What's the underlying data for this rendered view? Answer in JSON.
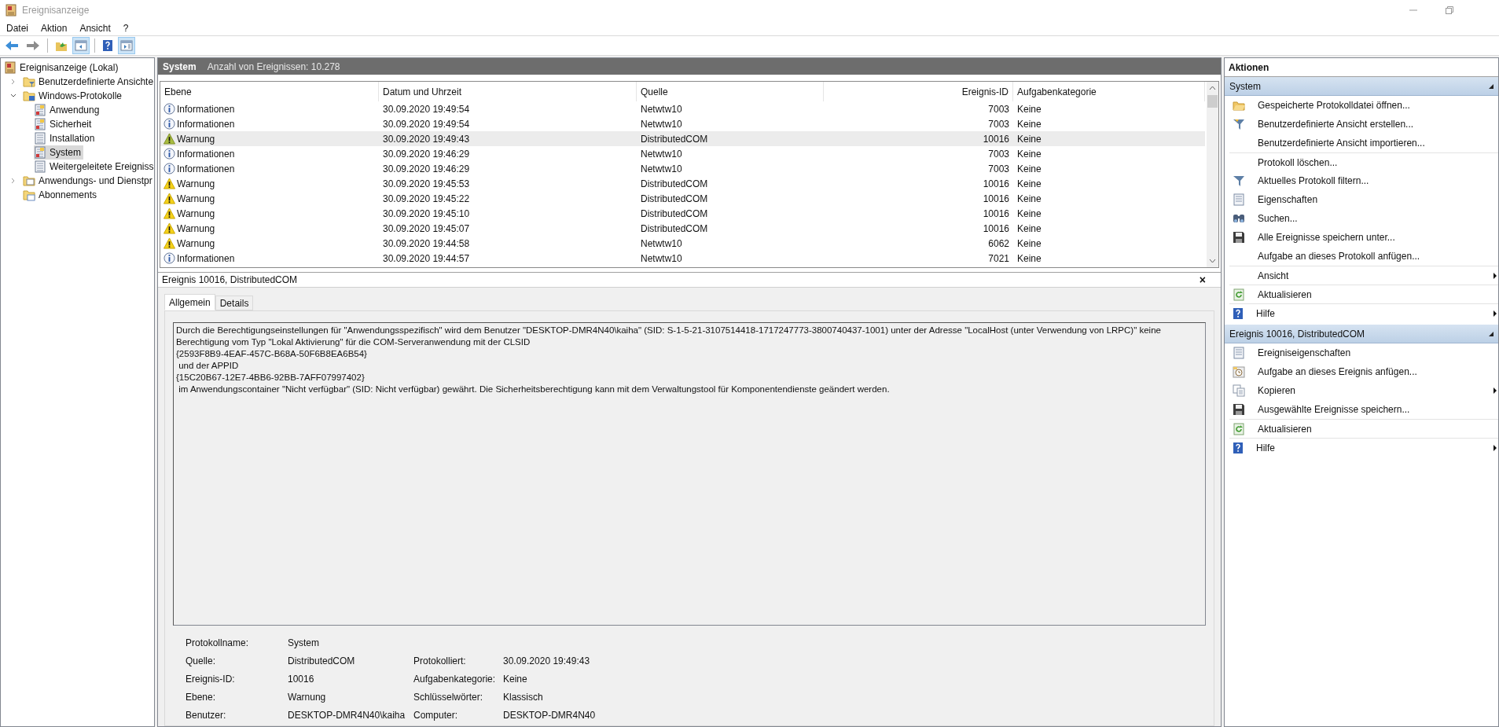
{
  "window": {
    "title": "Ereignisanzeige"
  },
  "menu": [
    "Datei",
    "Aktion",
    "Ansicht",
    "?"
  ],
  "toolbar": [
    {
      "buttons": [
        {
          "kind": "back",
          "selected": false
        },
        {
          "kind": "forward",
          "selected": false
        }
      ]
    },
    {
      "buttons": [
        {
          "kind": "up",
          "selected": false
        },
        {
          "kind": "tree-toggle",
          "selected": true
        }
      ]
    },
    {
      "buttons": [
        {
          "kind": "help",
          "selected": false
        },
        {
          "kind": "actions-toggle",
          "selected": true
        }
      ]
    }
  ],
  "tree": [
    {
      "label": "Ereignisanzeige (Lokal)",
      "kind": "app",
      "selected": false,
      "children": [
        {
          "label": "Benutzerdefinierte Ansichte",
          "kind": "folder-filter",
          "selected": false,
          "expanded": false
        },
        {
          "label": "Windows-Protokolle",
          "kind": "folder-pc",
          "selected": false,
          "expanded": true,
          "children": [
            {
              "label": "Anwendung",
              "kind": "log-marked",
              "selected": false
            },
            {
              "label": "Sicherheit",
              "kind": "log-marked",
              "selected": false
            },
            {
              "label": "Installation",
              "kind": "log",
              "selected": false
            },
            {
              "label": "System",
              "kind": "log-marked",
              "selected": true
            },
            {
              "label": "Weitergeleitete Ereigniss",
              "kind": "log",
              "selected": false
            }
          ]
        },
        {
          "label": "Anwendungs- und Dienstpr",
          "kind": "folder-doc",
          "selected": false,
          "expanded": false
        },
        {
          "label": "Abonnements",
          "kind": "folder-calendar",
          "selected": false
        }
      ]
    }
  ],
  "log_header": {
    "title": "System",
    "count": "Anzahl von Ereignissen: 10.278"
  },
  "table": {
    "columns": [
      "Ebene",
      "Datum und Uhrzeit",
      "Quelle",
      "Ereignis-ID",
      "Aufgabenkategorie"
    ],
    "rows": [
      {
        "kind": "info",
        "level": "Informationen",
        "date": "30.09.2020 19:49:54",
        "source": "Netwtw10",
        "id": "7003",
        "category": "Keine",
        "selected": false
      },
      {
        "kind": "info",
        "level": "Informationen",
        "date": "30.09.2020 19:49:54",
        "source": "Netwtw10",
        "id": "7003",
        "category": "Keine",
        "selected": false
      },
      {
        "kind": "warning",
        "level": "Warnung",
        "date": "30.09.2020 19:49:43",
        "source": "DistributedCOM",
        "id": "10016",
        "category": "Keine",
        "selected": true
      },
      {
        "kind": "info",
        "level": "Informationen",
        "date": "30.09.2020 19:46:29",
        "source": "Netwtw10",
        "id": "7003",
        "category": "Keine",
        "selected": false
      },
      {
        "kind": "info",
        "level": "Informationen",
        "date": "30.09.2020 19:46:29",
        "source": "Netwtw10",
        "id": "7003",
        "category": "Keine",
        "selected": false
      },
      {
        "kind": "warning",
        "level": "Warnung",
        "date": "30.09.2020 19:45:53",
        "source": "DistributedCOM",
        "id": "10016",
        "category": "Keine",
        "selected": false
      },
      {
        "kind": "warning",
        "level": "Warnung",
        "date": "30.09.2020 19:45:22",
        "source": "DistributedCOM",
        "id": "10016",
        "category": "Keine",
        "selected": false
      },
      {
        "kind": "warning",
        "level": "Warnung",
        "date": "30.09.2020 19:45:10",
        "source": "DistributedCOM",
        "id": "10016",
        "category": "Keine",
        "selected": false
      },
      {
        "kind": "warning",
        "level": "Warnung",
        "date": "30.09.2020 19:45:07",
        "source": "DistributedCOM",
        "id": "10016",
        "category": "Keine",
        "selected": false
      },
      {
        "kind": "warning",
        "level": "Warnung",
        "date": "30.09.2020 19:44:58",
        "source": "Netwtw10",
        "id": "6062",
        "category": "Keine",
        "selected": false
      },
      {
        "kind": "info",
        "level": "Informationen",
        "date": "30.09.2020 19:44:57",
        "source": "Netwtw10",
        "id": "7021",
        "category": "Keine",
        "selected": false
      }
    ]
  },
  "detail": {
    "title": "Ereignis 10016, DistributedCOM",
    "close": "×",
    "tabs": [
      {
        "label": "Allgemein",
        "selected": true
      },
      {
        "label": "Details",
        "selected": false
      }
    ],
    "message": "Durch die Berechtigungseinstellungen für \"Anwendungsspezifisch\" wird dem Benutzer \"DESKTOP-DMR4N40\\kaiha\" (SID: S-1-5-21-3107514418-1717247773-3800740437-1001) unter der Adresse \"LocalHost (unter Verwendung von LRPC)\" keine Berechtigung vom Typ \"Lokal Aktivierung\" für die COM-Serveranwendung mit der CLSID\n{2593F8B9-4EAF-457C-B68A-50F6B8EA6B54}\n und der APPID\n{15C20B67-12E7-4BB6-92BB-7AFF07997402}\n im Anwendungscontainer \"Nicht verfügbar\" (SID: Nicht verfügbar) gewährt. Die Sicherheitsberechtigung kann mit dem Verwaltungstool für Komponentendienste geändert werden.",
    "fields": [
      {
        "left": {
          "label": "Protokollname:",
          "value": "System"
        }
      },
      {
        "left": {
          "label": "Quelle:",
          "value": "DistributedCOM"
        },
        "right": {
          "label": "Protokolliert:",
          "value": "30.09.2020 19:49:43"
        }
      },
      {
        "left": {
          "label": "Ereignis-ID:",
          "value": "10016"
        },
        "right": {
          "label": "Aufgabenkategorie:",
          "value": "Keine"
        }
      },
      {
        "left": {
          "label": "Ebene:",
          "value": "Warnung"
        },
        "right": {
          "label": "Schlüsselwörter:",
          "value": "Klassisch"
        }
      },
      {
        "left": {
          "label": "Benutzer:",
          "value": "DESKTOP-DMR4N40\\kaiha"
        },
        "right": {
          "label": "Computer:",
          "value": "DESKTOP-DMR4N40"
        }
      }
    ]
  },
  "actions": {
    "title": "Aktionen",
    "sections": [
      {
        "title": "System",
        "expanded": true,
        "items": [
          {
            "label": "Gespeicherte Protokolldatei öffnen...",
            "kind": "folder",
            "divider": false,
            "submenu": false
          },
          {
            "label": "Benutzerdefinierte Ansicht erstellen...",
            "kind": "filter-star",
            "divider": false,
            "submenu": false
          },
          {
            "label": "Benutzerdefinierte Ansicht importieren...",
            "kind": "none",
            "divider": false,
            "submenu": false
          },
          {
            "label": "Protokoll löschen...",
            "kind": "none",
            "divider": true,
            "submenu": false
          },
          {
            "label": "Aktuelles Protokoll filtern...",
            "kind": "filter",
            "divider": false,
            "submenu": false
          },
          {
            "label": "Eigenschaften",
            "kind": "properties",
            "divider": false,
            "submenu": false
          },
          {
            "label": "Suchen...",
            "kind": "binoculars",
            "divider": false,
            "submenu": false
          },
          {
            "label": "Alle Ereignisse speichern unter...",
            "kind": "save",
            "divider": false,
            "submenu": false
          },
          {
            "label": "Aufgabe an dieses Protokoll anfügen...",
            "kind": "none",
            "divider": false,
            "submenu": false
          },
          {
            "label": "Ansicht",
            "kind": "none",
            "divider": true,
            "submenu": true
          },
          {
            "label": "Aktualisieren",
            "kind": "refresh",
            "divider": true,
            "submenu": false
          },
          {
            "label": "Hilfe",
            "kind": "help",
            "divider": true,
            "submenu": true
          }
        ]
      },
      {
        "title": "Ereignis 10016, DistributedCOM",
        "expanded": true,
        "items": [
          {
            "label": "Ereigniseigenschaften",
            "kind": "properties",
            "divider": false,
            "submenu": false
          },
          {
            "label": "Aufgabe an dieses Ereignis anfügen...",
            "kind": "task",
            "divider": false,
            "submenu": false
          },
          {
            "label": "Kopieren",
            "kind": "copy",
            "divider": false,
            "submenu": true
          },
          {
            "label": "Ausgewählte Ereignisse speichern...",
            "kind": "save",
            "divider": false,
            "submenu": false
          },
          {
            "label": "Aktualisieren",
            "kind": "refresh",
            "divider": true,
            "submenu": false
          },
          {
            "label": "Hilfe",
            "kind": "help",
            "divider": true,
            "submenu": true
          }
        ]
      }
    ]
  }
}
